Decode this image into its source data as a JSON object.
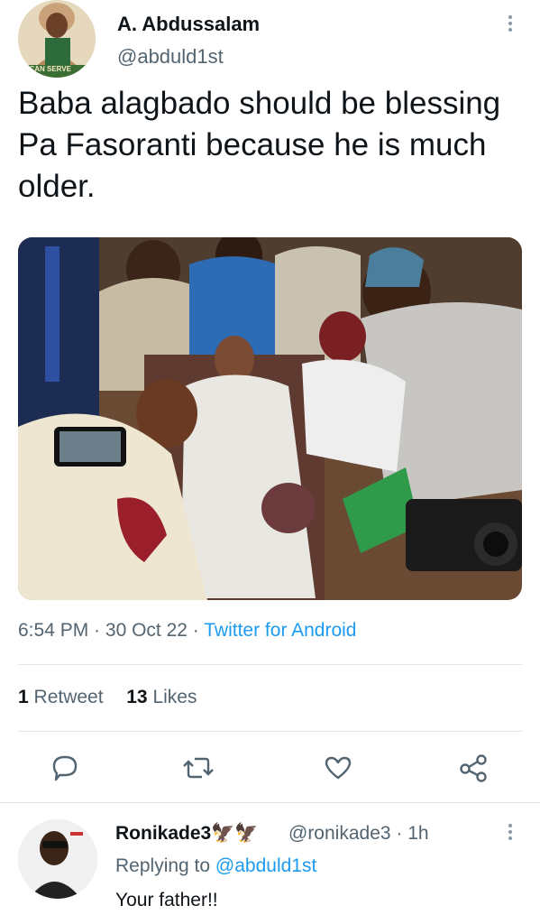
{
  "tweet": {
    "author_name": "A. Abdussalam",
    "author_handle": "@abduld1st",
    "avatar_caption": "I CAN SERVE",
    "text": "Baba alagbado should be blessing Pa Fasoranti because he is much older.",
    "time": "6:54 PM",
    "date": "30 Oct 22",
    "separator": " · ",
    "source": "Twitter for Android",
    "retweets_count": "1",
    "retweets_label": " Retweet",
    "likes_count": "13",
    "likes_label": " Likes"
  },
  "icons": {
    "more": "more-icon",
    "reply": "reply-icon",
    "retweet": "retweet-icon",
    "like": "heart-icon",
    "share": "share-icon"
  },
  "reply": {
    "author_name": "Ronikade3",
    "emoji": "🦅🦅",
    "author_handle": "@ronikade3",
    "time": "1h",
    "replying_prefix": "Replying to ",
    "replying_to": "@abduld1st",
    "text": "Your father!!"
  },
  "colors": {
    "text": "#0f1419",
    "secondary": "#536471",
    "link": "#1d9bf0",
    "divider": "#e3e6e8"
  }
}
